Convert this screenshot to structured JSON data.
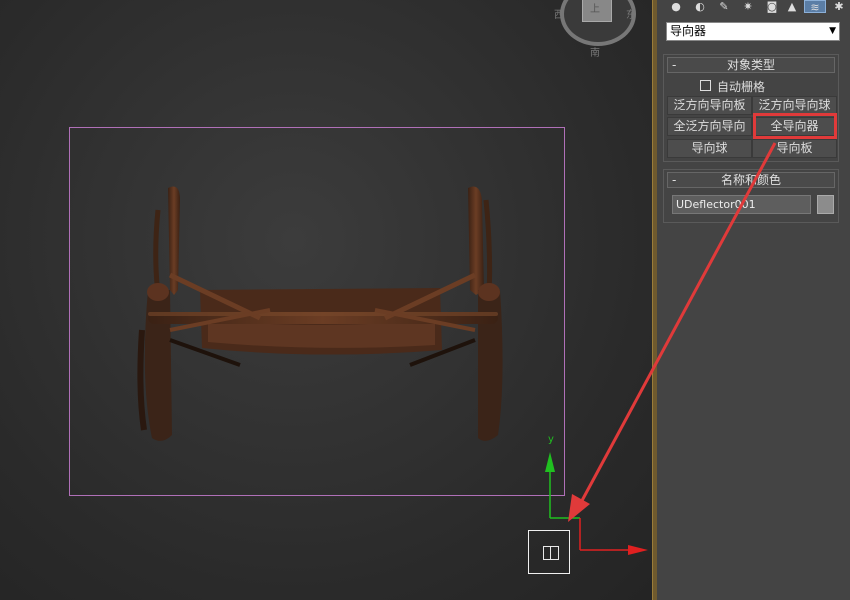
{
  "viewport": {
    "viewcube": {
      "top_label": "上",
      "left_label": "西",
      "right_label": "东",
      "bottom_label": "南"
    },
    "gizmo": {
      "y_axis_label": "y"
    }
  },
  "panel": {
    "tabs": [
      {
        "icon": "create-icon"
      },
      {
        "icon": "geometry-icon"
      },
      {
        "icon": "shapes-icon"
      },
      {
        "icon": "lights-icon"
      },
      {
        "icon": "cameras-icon"
      },
      {
        "icon": "helpers-icon"
      },
      {
        "icon": "space-warps-icon",
        "active": true
      },
      {
        "icon": "systems-icon"
      }
    ],
    "category": "导向器",
    "object_type": {
      "title": "对象类型",
      "collapse": "-",
      "autogrid_label": "自动栅格",
      "buttons": [
        "泛方向导向板",
        "泛方向导向球",
        "全泛方向导向",
        "全导向器",
        "导向球",
        "导向板"
      ]
    },
    "name_color": {
      "title": "名称和颜色",
      "collapse": "-",
      "name_value": "UDeflector001",
      "swatch_color": "#8c8c8c"
    }
  },
  "colors": {
    "highlight": "#e03a3a",
    "selection_box": "#b070b8",
    "gizmo_x": "#e02020",
    "gizmo_y": "#20c020"
  }
}
